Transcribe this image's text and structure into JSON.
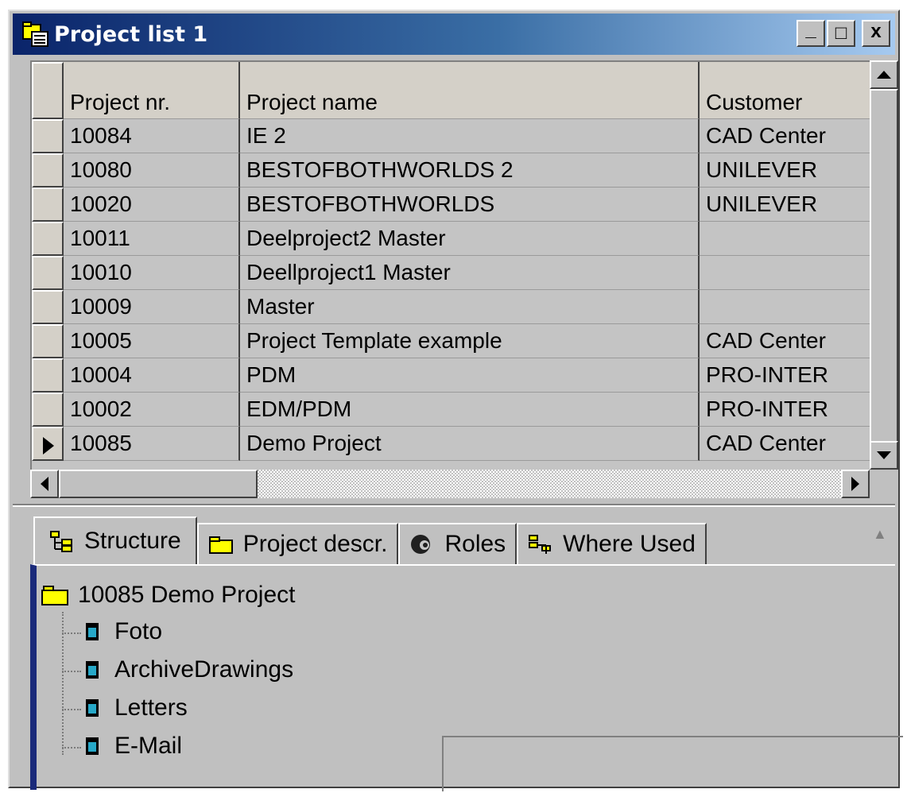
{
  "window": {
    "title": "Project list 1",
    "buttons": {
      "minimize": "_",
      "maximize": "□",
      "close": "x"
    }
  },
  "grid": {
    "columns": [
      "Project nr.",
      "Project name",
      "Customer"
    ],
    "rows": [
      {
        "nr": "10084",
        "name": "IE 2",
        "customer": "CAD Center"
      },
      {
        "nr": "10080",
        "name": "BESTOFBOTHWORLDS 2",
        "customer": "UNILEVER"
      },
      {
        "nr": "10020",
        "name": "BESTOFBOTHWORLDS",
        "customer": "UNILEVER"
      },
      {
        "nr": "10011",
        "name": "Deelproject2 Master",
        "customer": ""
      },
      {
        "nr": "10010",
        "name": "Deellproject1 Master",
        "customer": ""
      },
      {
        "nr": "10009",
        "name": "Master",
        "customer": ""
      },
      {
        "nr": "10005",
        "name": "Project Template example",
        "customer": "CAD Center"
      },
      {
        "nr": "10004",
        "name": "PDM",
        "customer": "PRO-INTER"
      },
      {
        "nr": "10002",
        "name": "EDM/PDM",
        "customer": "PRO-INTER"
      },
      {
        "nr": "10085",
        "name": "Demo Project",
        "customer": "CAD Center"
      }
    ],
    "current_row": "10085"
  },
  "tabs": [
    {
      "label": "Structure",
      "icon": "structure-icon"
    },
    {
      "label": "Project descr.",
      "icon": "folder-icon"
    },
    {
      "label": "Roles",
      "icon": "roles-icon"
    },
    {
      "label": "Where Used",
      "icon": "where-used-icon"
    }
  ],
  "tree": {
    "root": "10085 Demo Project",
    "children": [
      "Foto",
      "ArchiveDrawings",
      "Letters",
      "E-Mail"
    ]
  },
  "colors": {
    "title_start": "#0a246a",
    "title_end": "#a6caf0",
    "panel_edge": "#1a2a7a",
    "folder": "#ffff00",
    "doc": "#27a8c8"
  }
}
